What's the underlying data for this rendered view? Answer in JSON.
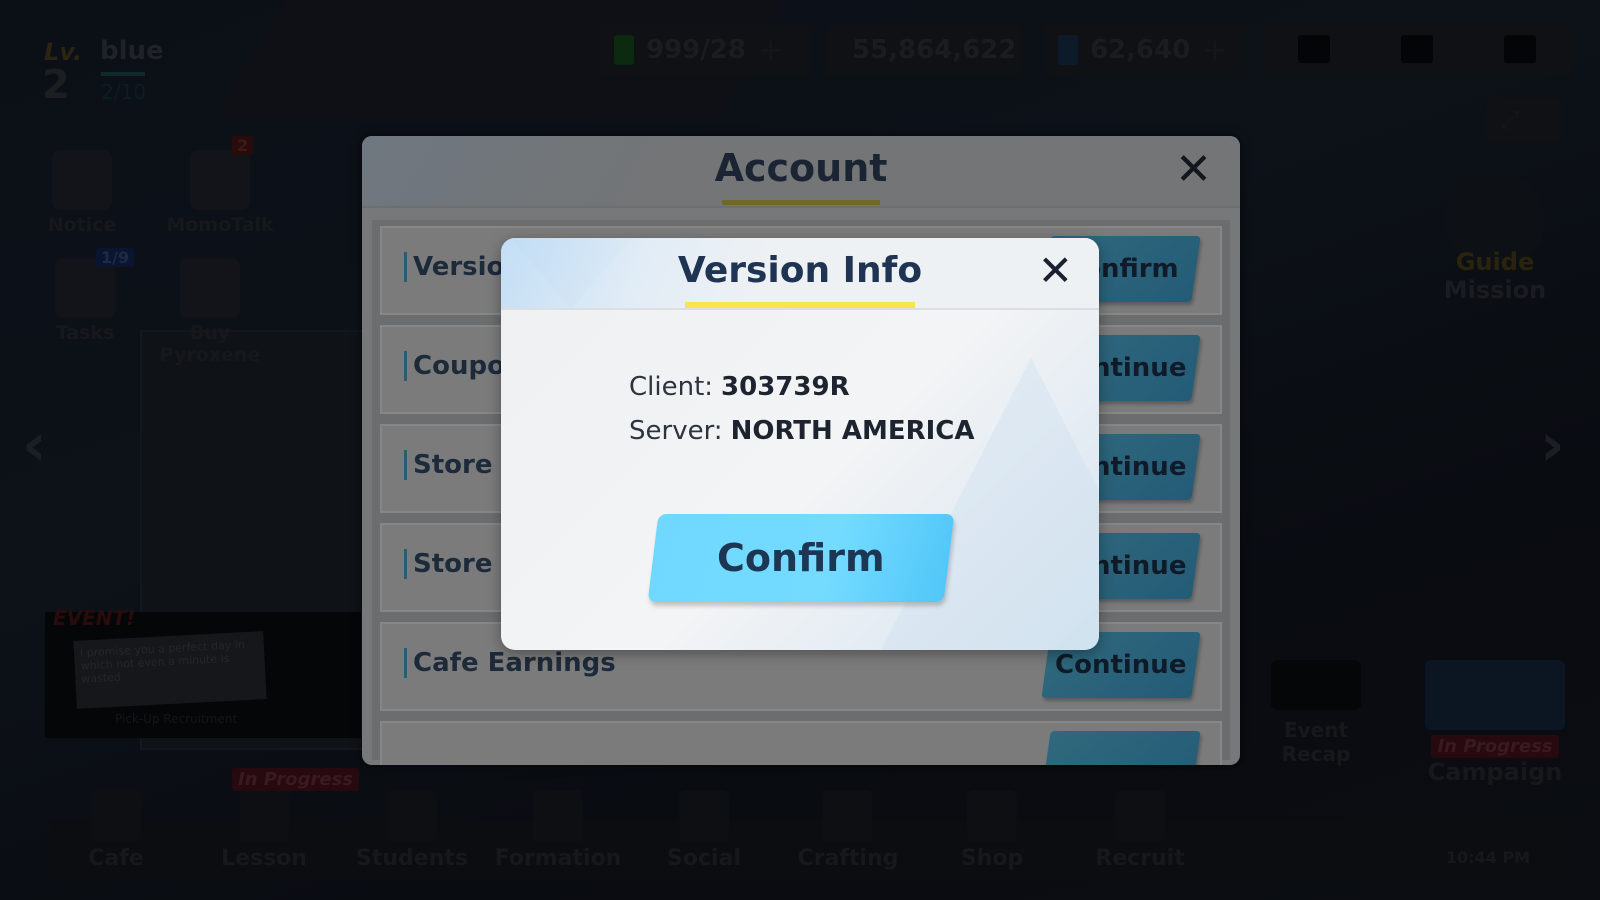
{
  "hud": {
    "level_label": "Lv.",
    "level": "2",
    "username": "blue",
    "exp": "2/10",
    "ap": "999/28",
    "credits": "55,864,622",
    "pyroxene": "62,640",
    "plus": "+"
  },
  "side": {
    "notice": "Notice",
    "momotalk": "MomoTalk",
    "momotalk_badge": "2",
    "tasks": "Tasks",
    "tasks_badge": "1/9",
    "buy_pyroxene": "Buy Pyroxene"
  },
  "event": {
    "title": "EVENT!",
    "card_text": "I promise you a perfect day in which not even a minute is wasted",
    "subtitle": "Pick-Up Recruitment"
  },
  "right": {
    "guide_mission_1": "Guide",
    "guide_mission_2": "Mission",
    "event_recap": "Event Recap",
    "campaign_status": "In Progress",
    "campaign": "Campaign"
  },
  "nav": {
    "items": [
      "Cafe",
      "Lesson",
      "Students",
      "Formation",
      "Social",
      "Crafting",
      "Shop",
      "Recruit"
    ],
    "lesson_status": "In Progress",
    "clock": "10:44 PM"
  },
  "account": {
    "title": "Account",
    "rows": [
      {
        "label": "Version",
        "button": "Confirm"
      },
      {
        "label": "Coupon",
        "button": "Continue"
      },
      {
        "label": "Store a",
        "button": "Continue"
      },
      {
        "label": "Store a",
        "button": "Continue"
      },
      {
        "label": "Cafe Earnings",
        "button": "Continue"
      }
    ]
  },
  "version_dialog": {
    "title": "Version Info",
    "client_label": "Client:",
    "client_value": "303739R",
    "server_label": "Server:",
    "server_value": "NORTH AMERICA",
    "confirm": "Confirm"
  },
  "colors": {
    "accent_underline": "#f7e64a",
    "confirm_button": "#70d8ff",
    "title_text": "#1f3452"
  }
}
